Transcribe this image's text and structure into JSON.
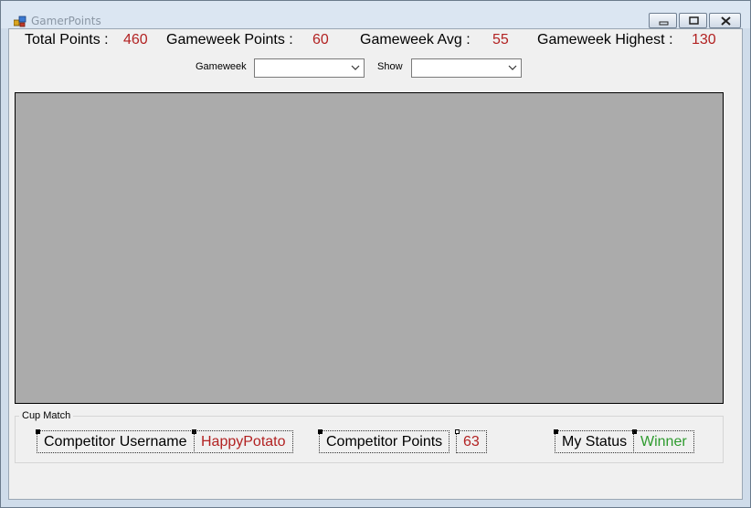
{
  "window": {
    "title": "GamerPoints"
  },
  "stats": {
    "total_points_label": "Total Points :",
    "total_points_value": "460",
    "gameweek_points_label": "Gameweek Points :",
    "gameweek_points_value": "60",
    "gameweek_avg_label": "Gameweek Avg :",
    "gameweek_avg_value": "55",
    "gameweek_highest_label": "Gameweek Highest :",
    "gameweek_highest_value": "130"
  },
  "filters": {
    "gameweek_label": "Gameweek",
    "gameweek_value": "",
    "show_label": "Show",
    "show_value": ""
  },
  "cup_match": {
    "group_title": "Cup Match",
    "competitor_username_label": "Competitor Username",
    "competitor_username_value": "HappyPotato",
    "competitor_points_label": "Competitor Points",
    "competitor_points_value": "63",
    "my_status_label": "My Status",
    "my_status_value": "Winner"
  },
  "colors": {
    "value_red": "#b22222",
    "status_green": "#2e9b2e",
    "panel_gray": "#ababab"
  },
  "icons": {
    "app": "app-icon",
    "minimize": "minimize-icon",
    "maximize": "maximize-icon",
    "close": "close-icon",
    "dropdown": "chevron-down-icon"
  }
}
